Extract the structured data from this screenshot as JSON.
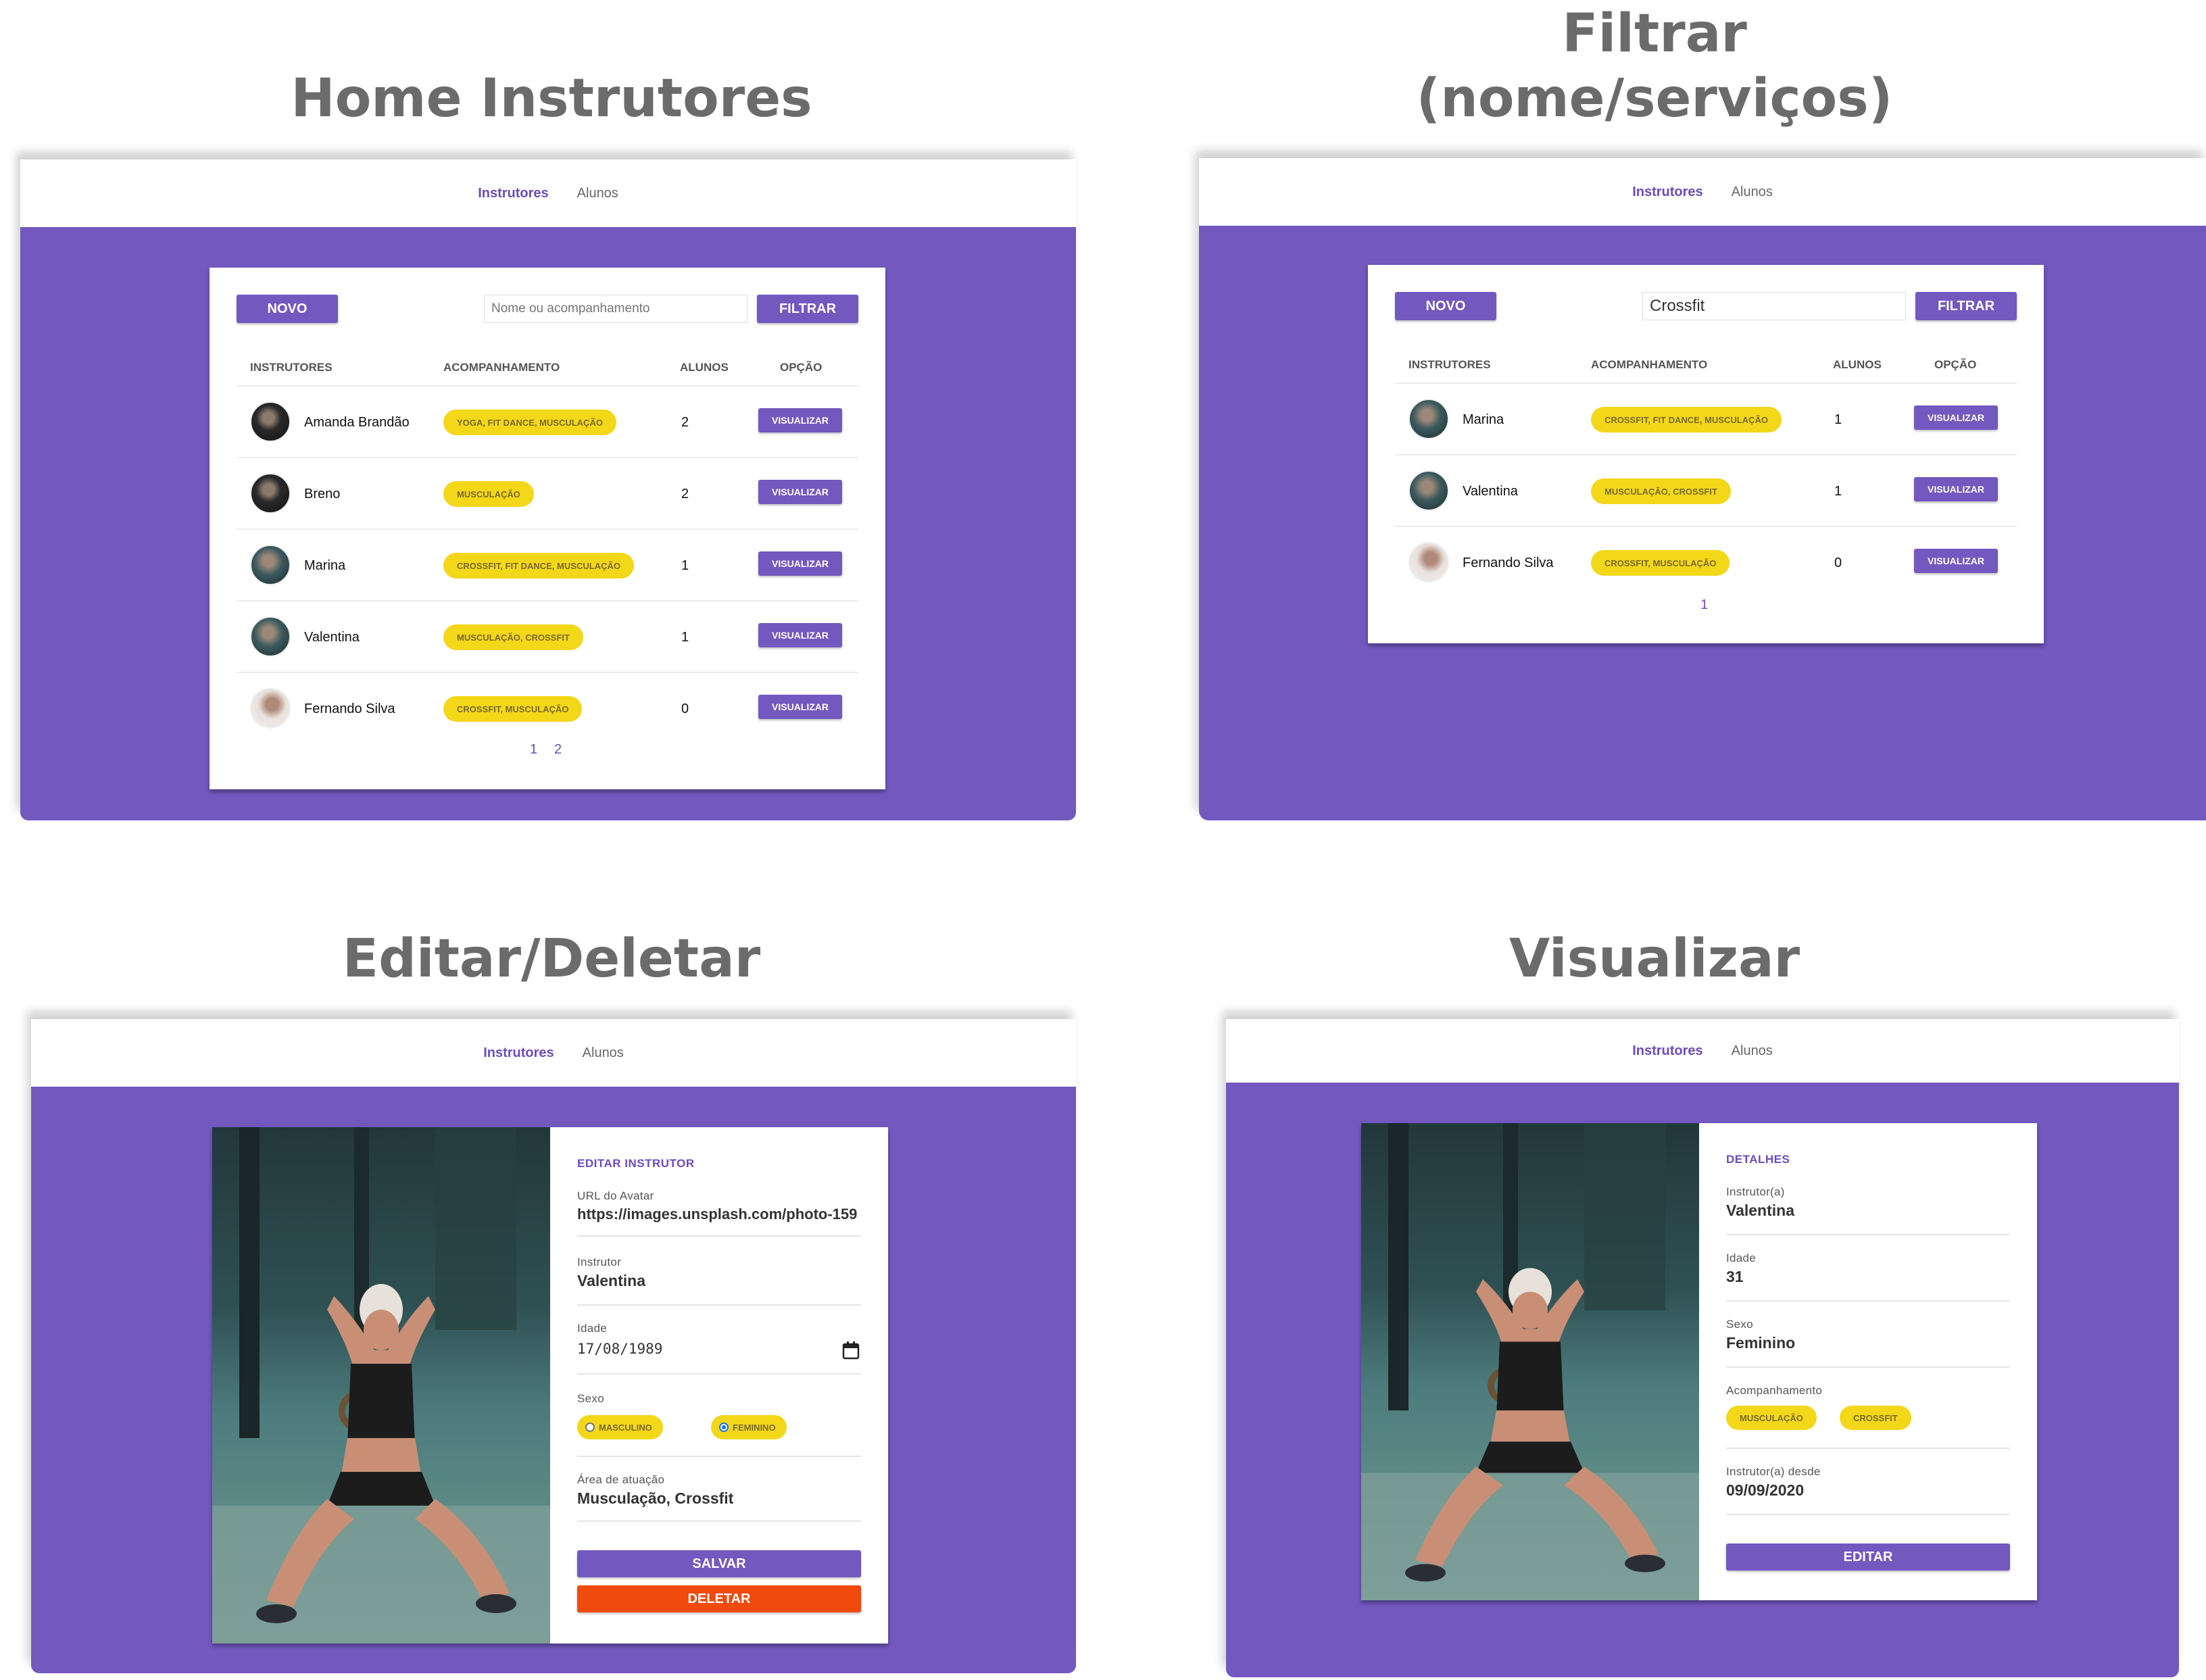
{
  "sections": {
    "home": {
      "title": "Home Instrutores"
    },
    "filter": {
      "title_line1": "Filtrar",
      "title_line2": "(nome/serviços)"
    },
    "edit": {
      "title": "Editar/Deletar"
    },
    "view": {
      "title": "Visualizar"
    }
  },
  "nav": {
    "instructors": "Instrutores",
    "students": "Alunos"
  },
  "home": {
    "new_label": "NOVO",
    "search_placeholder": "Nome ou acompanhamento",
    "filter_label": "FILTRAR",
    "columns": [
      "INSTRUTORES",
      "ACOMPANHAMENTO",
      "ALUNOS",
      "OPÇÃO"
    ],
    "rows": [
      {
        "name": "Amanda Brandão",
        "services": "YOGA, FIT DANCE, MUSCULAÇÃO",
        "students": "2",
        "action": "VISUALIZAR"
      },
      {
        "name": "Breno",
        "services": "MUSCULAÇÃO",
        "students": "2",
        "action": "VISUALIZAR"
      },
      {
        "name": "Marina",
        "services": "CROSSFIT, FIT DANCE, MUSCULAÇÃO",
        "students": "1",
        "action": "VISUALIZAR"
      },
      {
        "name": "Valentina",
        "services": "MUSCULAÇÃO, CROSSFIT",
        "students": "1",
        "action": "VISUALIZAR"
      },
      {
        "name": "Fernando Silva",
        "services": "CROSSFIT, MUSCULAÇÃO",
        "students": "0",
        "action": "VISUALIZAR"
      }
    ],
    "pages": [
      "1",
      "2"
    ]
  },
  "filter": {
    "new_label": "NOVO",
    "search_value": "Crossfit",
    "filter_label": "FILTRAR",
    "columns": [
      "INSTRUTORES",
      "ACOMPANHAMENTO",
      "ALUNOS",
      "OPÇÃO"
    ],
    "rows": [
      {
        "name": "Marina",
        "services": "CROSSFIT, FIT DANCE, MUSCULAÇÃO",
        "students": "1",
        "action": "VISUALIZAR"
      },
      {
        "name": "Valentina",
        "services": "MUSCULAÇÃO, CROSSFIT",
        "students": "1",
        "action": "VISUALIZAR"
      },
      {
        "name": "Fernando Silva",
        "services": "CROSSFIT, MUSCULAÇÃO",
        "students": "0",
        "action": "VISUALIZAR"
      }
    ],
    "pages": [
      "1"
    ]
  },
  "edit": {
    "heading": "EDITAR INSTRUTOR",
    "avatar_label": "URL do Avatar",
    "avatar_value": "https://images.unsplash.com/photo-159",
    "instructor_label": "Instrutor",
    "instructor_value": "Valentina",
    "age_label": "Idade",
    "age_value": "17/08/1989",
    "sex_label": "Sexo",
    "sex_options": [
      "MASCULINO",
      "FEMININO"
    ],
    "sex_selected": "FEMININO",
    "area_label": "Área de atuação",
    "area_value": "Musculação, Crossfit",
    "save_label": "SALVAR",
    "delete_label": "DELETAR"
  },
  "view": {
    "heading": "DETALHES",
    "instructor_label": "Instrutor(a)",
    "instructor_value": "Valentina",
    "age_label": "Idade",
    "age_value": "31",
    "sex_label": "Sexo",
    "sex_value": "Feminino",
    "services_label": "Acompanhamento",
    "services": [
      "MUSCULAÇÃO",
      "CROSSFIT"
    ],
    "since_label": "Instrutor(a) desde",
    "since_value": "09/09/2020",
    "edit_label": "EDITAR"
  },
  "colors": {
    "primary": "#7358c0",
    "tag": "#f3d719",
    "delete": "#f04a0c",
    "title": "#6b6b6b"
  },
  "icons": [
    "calendar-icon"
  ]
}
